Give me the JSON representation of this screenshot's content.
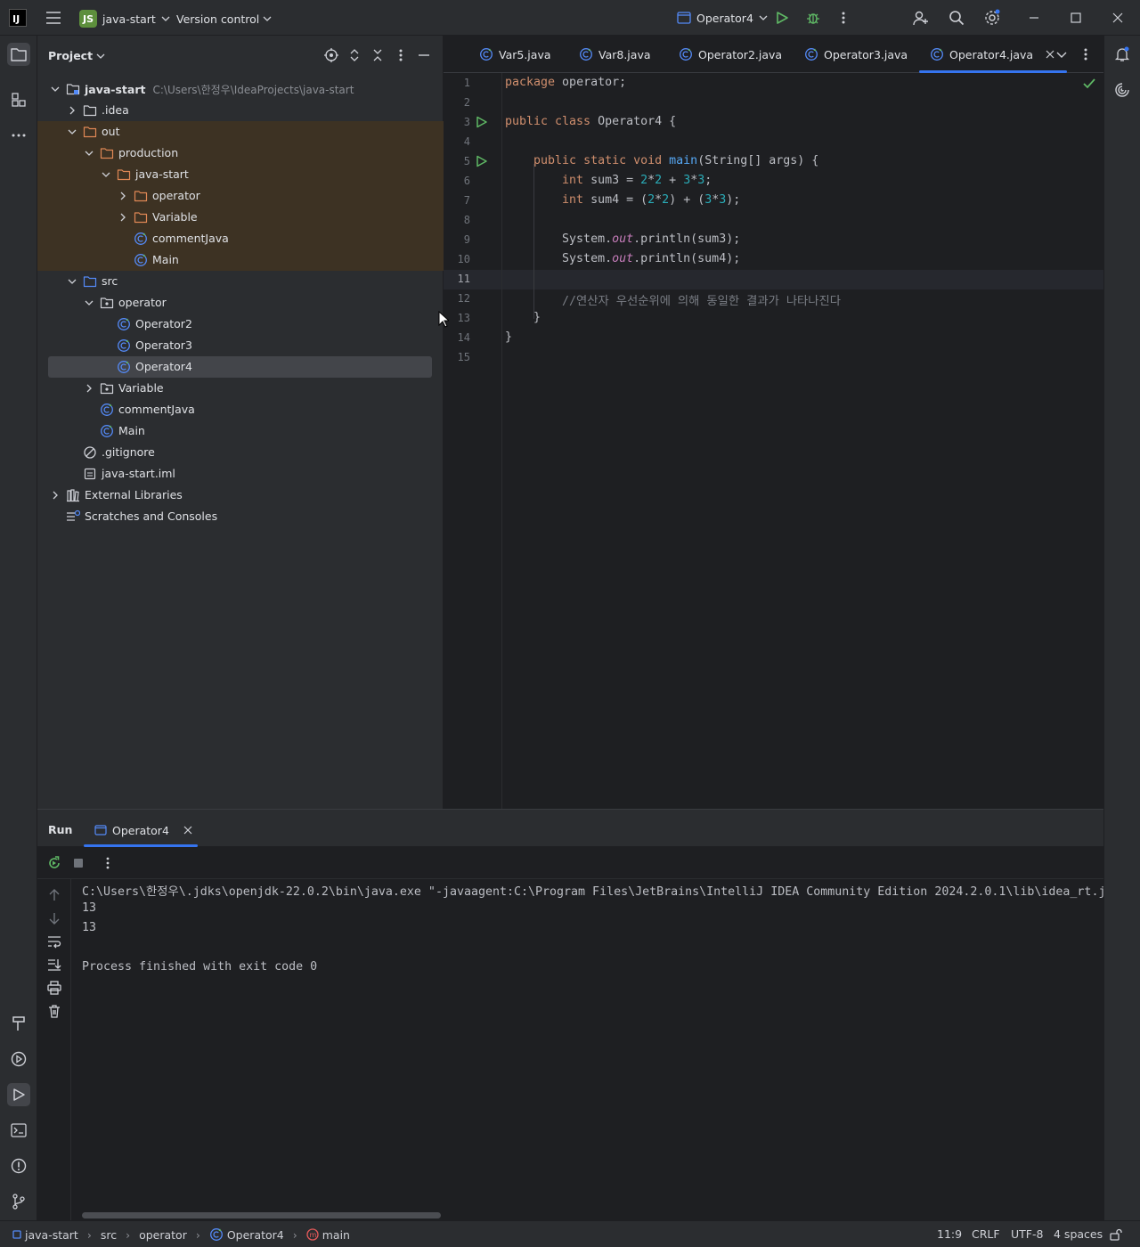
{
  "titlebar": {
    "project_badge": "JS",
    "project_name": "java-start",
    "vcs": "Version control",
    "run_config": "Operator4"
  },
  "project_panel": {
    "title": "Project",
    "tree": [
      {
        "label": "java-start",
        "path": "C:\\Users\\한정우\\IdeaProjects\\java-start",
        "depth": 0,
        "icon": "module-folder-icon",
        "expanded": true,
        "bold": true
      },
      {
        "label": ".idea",
        "depth": 1,
        "icon": "folder-icon",
        "expanded": false
      },
      {
        "label": "out",
        "depth": 1,
        "icon": "folder-excluded-icon",
        "expanded": true,
        "excluded": true
      },
      {
        "label": "production",
        "depth": 2,
        "icon": "folder-excluded-icon",
        "expanded": true,
        "excluded": true
      },
      {
        "label": "java-start",
        "depth": 3,
        "icon": "folder-excluded-icon",
        "expanded": true,
        "excluded": true
      },
      {
        "label": "operator",
        "depth": 4,
        "icon": "folder-excluded-icon",
        "expanded": false,
        "excluded": true
      },
      {
        "label": "Variable",
        "depth": 4,
        "icon": "folder-excluded-icon",
        "expanded": false,
        "excluded": true
      },
      {
        "label": "commentJava",
        "depth": 4,
        "icon": "class-icon",
        "excluded": true
      },
      {
        "label": "Main",
        "depth": 4,
        "icon": "class-icon",
        "excluded": true
      },
      {
        "label": "src",
        "depth": 1,
        "icon": "source-folder-icon",
        "expanded": true
      },
      {
        "label": "operator",
        "depth": 2,
        "icon": "package-icon",
        "expanded": true
      },
      {
        "label": "Operator2",
        "depth": 3,
        "icon": "class-icon"
      },
      {
        "label": "Operator3",
        "depth": 3,
        "icon": "class-icon"
      },
      {
        "label": "Operator4",
        "depth": 3,
        "icon": "class-icon",
        "selected": true
      },
      {
        "label": "Variable",
        "depth": 2,
        "icon": "package-icon",
        "expanded": false
      },
      {
        "label": "commentJava",
        "depth": 2,
        "icon": "class-icon"
      },
      {
        "label": "Main",
        "depth": 2,
        "icon": "class-icon"
      },
      {
        "label": ".gitignore",
        "depth": 1,
        "icon": "ignore-file-icon"
      },
      {
        "label": "java-start.iml",
        "depth": 1,
        "icon": "iml-file-icon"
      },
      {
        "label": "External Libraries",
        "depth": 0,
        "icon": "library-icon",
        "expanded": false
      },
      {
        "label": "Scratches and Consoles",
        "depth": 0,
        "icon": "scratches-icon"
      }
    ]
  },
  "editor": {
    "tabs": [
      {
        "label": "Var5.java"
      },
      {
        "label": "Var8.java"
      },
      {
        "label": "Operator2.java"
      },
      {
        "label": "Operator3.java"
      },
      {
        "label": "Operator4.java",
        "active": true
      }
    ],
    "line_numbers": [
      "1",
      "2",
      "3",
      "4",
      "5",
      "6",
      "7",
      "8",
      "9",
      "10",
      "11",
      "12",
      "13",
      "14",
      "15"
    ],
    "current_line": "11"
  },
  "run_panel": {
    "title": "Run",
    "tab": "Operator4",
    "console": [
      "C:\\Users\\한정우\\.jdks\\openjdk-22.0.2\\bin\\java.exe \"-javaagent:C:\\Program Files\\JetBrains\\IntelliJ IDEA Community Edition 2024.2.0.1\\lib\\idea_rt.j",
      "13",
      "13",
      "",
      "Process finished with exit code 0"
    ]
  },
  "statusbar": {
    "breadcrumb": [
      "java-start",
      "src",
      "operator",
      "Operator4",
      "main"
    ],
    "position": "11:9",
    "line_separator": "CRLF",
    "encoding": "UTF-8",
    "indent": "4 spaces"
  },
  "colors": {
    "accent": "#3574f0",
    "run_green": "#5fb865",
    "excluded_bg": "#3d3223"
  }
}
